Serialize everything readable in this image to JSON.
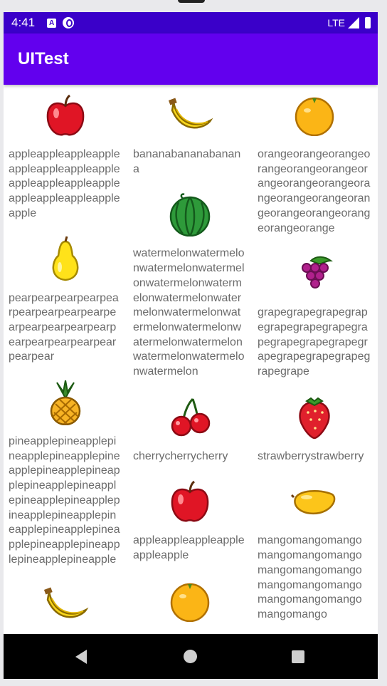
{
  "status": {
    "time": "4:41",
    "network": "LTE"
  },
  "app": {
    "title": "UITest"
  },
  "columns": [
    [
      {
        "icon": "apple",
        "name": "appleappleappleappleappleappleappleappleappleappleappleappleappleappleappleappleapple"
      },
      {
        "icon": "pear",
        "name": "pearpearpearpearpearpearpearpearpearpearpearpearpearpearpearpearpearpearpearpearpear"
      },
      {
        "icon": "pineapple",
        "name": "pineapplepineapplepineapplepineapplepineapplepineapplepineapplepineapplepineapplepineapplepineapplepineapplepineapplepineapplepineapplepineapplepineapplepineapplepineapplepineapple"
      },
      {
        "icon": "banana",
        "name": ""
      }
    ],
    [
      {
        "icon": "banana",
        "name": "bananabananabanana"
      },
      {
        "icon": "watermelon",
        "name": "watermelonwatermelonwatermelonwatermelonwatermelonwatermelonwatermelonwatermelonwatermelonwatermelonwatermelonwatermelonwatermelonwatermelonwatermelonwatermelon"
      },
      {
        "icon": "cherry",
        "name": "cherrycherrycherry"
      },
      {
        "icon": "apple",
        "name": "appleappleappleappleappleapple"
      },
      {
        "icon": "orange",
        "name": ""
      }
    ],
    [
      {
        "icon": "orange",
        "name": "orangeorangeorangeorangeorangeorangeorangeorangeorangeorangeorangeorangeorangeorangeorangeorangeorangeorange"
      },
      {
        "icon": "grape",
        "name": "grapegrapegrapegrapegrapegrapegrapegrapegrapegrapegrapegrapegrapegrapegrapegrapegrape"
      },
      {
        "icon": "strawberry",
        "name": "strawberrystrawberry"
      },
      {
        "icon": "mango",
        "name": "mangomangomangomangomangomangomangomangomangomangomangomangomangomangomangomangomango"
      }
    ]
  ],
  "colors": {
    "status_bar": "#3a00c9",
    "app_bar": "#6200ee",
    "text": "#6b6b6b"
  }
}
